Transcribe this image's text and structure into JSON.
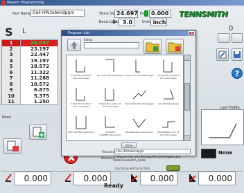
{
  "window": {
    "title": "Maxent Programming"
  },
  "header": {
    "part_name_label": "Part Name",
    "part_name_value": "Oak HW.tobendpgm",
    "stock_size_label": "Stock Size",
    "stock_size_value": "24.697",
    "end_label": "End",
    "end_value": "0.000",
    "bend_limits_label": "Bend Limits",
    "bend_limits_value": "3.0",
    "units_label": "Units",
    "units_value": "inch",
    "logo_text": "TENNSMITH",
    "top_right_value": "0"
  },
  "table": {
    "col_left": "S",
    "col_right": "L",
    "rows": [
      {
        "n": "1",
        "v": "24.097"
      },
      {
        "n": "2",
        "v": "23.197"
      },
      {
        "n": "3",
        "v": "22.447"
      },
      {
        "n": "4",
        "v": "19.197"
      },
      {
        "n": "5",
        "v": "18.572"
      },
      {
        "n": "6",
        "v": "11.322"
      },
      {
        "n": "7",
        "v": "11.288"
      },
      {
        "n": "8",
        "v": "10.572"
      },
      {
        "n": "9",
        "v": "6.875"
      },
      {
        "n": "10",
        "v": "5.375"
      },
      {
        "n": "11",
        "v": "1.250"
      }
    ]
  },
  "dialog": {
    "title": "Program List",
    "select_label": "Select",
    "drive_label": "Drive",
    "filename_label": "Filename",
    "filename_value": "Oak HW.tobendpgm",
    "directory_label": "Directory",
    "directory_value": "C:\\Documents and Settings\\All Users\\Application Data\\Tennsmith\\_Folder",
    "last_scanned_label": "Last Scanned Cycle Data",
    "items": [
      {
        "label": "6 Style Box Gutter 8 Inch.tobendpgm"
      },
      {
        "label": "LR Corner Fill.tobendpgm"
      },
      {
        "label": "Long Lance Flat.tobendpgm"
      },
      {
        "label": "6K Style Box Gutter 8 Inch.tobendpgm"
      },
      {
        "label": "K Style Box Gutter 6 Inch.tobendpgm"
      },
      {
        "label": "K Style Box Gutter 12 Inch.tobendpgm"
      },
      {
        "label": "Ratchet&Gutter.tobendpgm"
      },
      {
        "label": "Oak HW.tobendpgm"
      },
      {
        "label": "BOX GUTTER.tobendpgm"
      },
      {
        "label": "OUTSIDE CORNER.tobendpgm"
      },
      {
        "label": "Radial&Gutter.tobendpgm"
      },
      {
        "label": "Pocket&Step Trim 76 Inch.tobendpgm"
      }
    ]
  },
  "right_panel": {
    "last_profile_label": "Last Profile",
    "none_label": "None",
    "none_value": "None"
  },
  "bottom": {
    "values": [
      "0.000",
      "0.000",
      "0.000",
      "0.000"
    ],
    "status": "Ready"
  },
  "colors": {
    "accent_green": "#2a8a3a",
    "selected_row": "#d92020",
    "selected_value": "#00e040"
  }
}
